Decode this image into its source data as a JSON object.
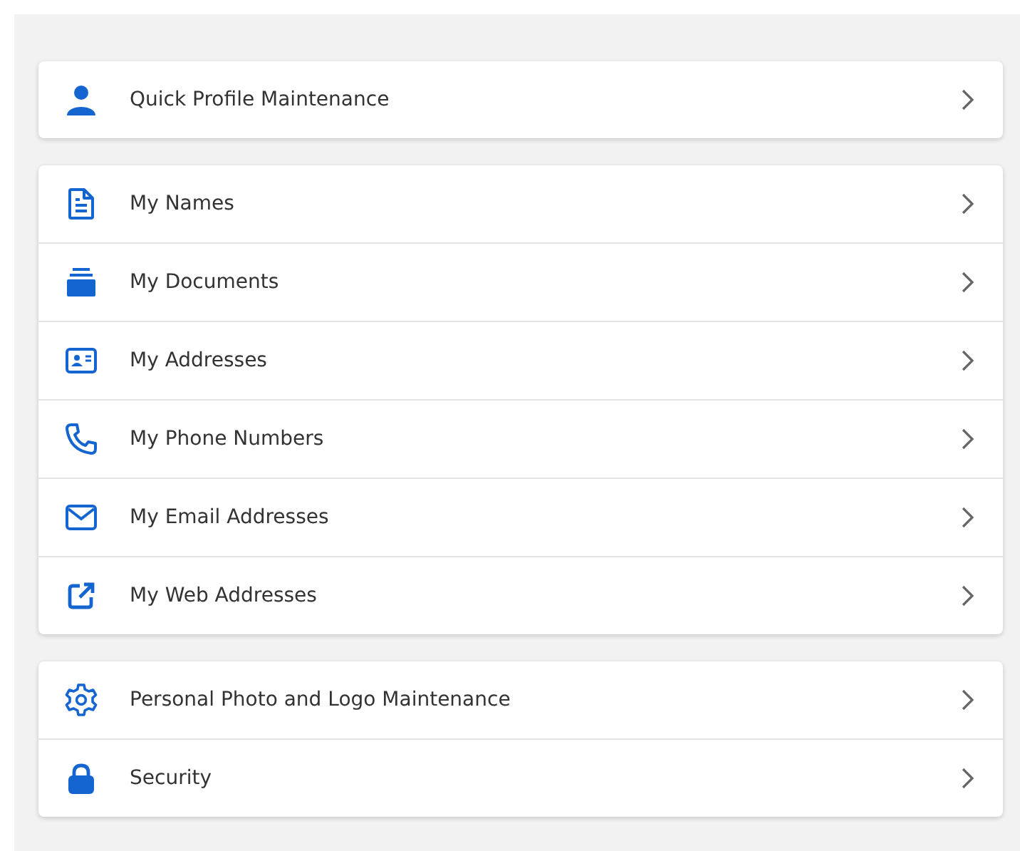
{
  "groups": [
    {
      "items": [
        {
          "kind": "person",
          "label": "Quick Profile Maintenance"
        }
      ]
    },
    {
      "items": [
        {
          "kind": "document",
          "label": "My Names"
        },
        {
          "kind": "stack",
          "label": "My Documents"
        },
        {
          "kind": "card",
          "label": "My Addresses"
        },
        {
          "kind": "phone",
          "label": "My Phone Numbers"
        },
        {
          "kind": "mail",
          "label": "My Email Addresses"
        },
        {
          "kind": "external",
          "label": "My Web Addresses"
        }
      ]
    },
    {
      "items": [
        {
          "kind": "gear",
          "label": "Personal Photo and Logo Maintenance"
        },
        {
          "kind": "lock",
          "label": "Security"
        }
      ]
    }
  ]
}
